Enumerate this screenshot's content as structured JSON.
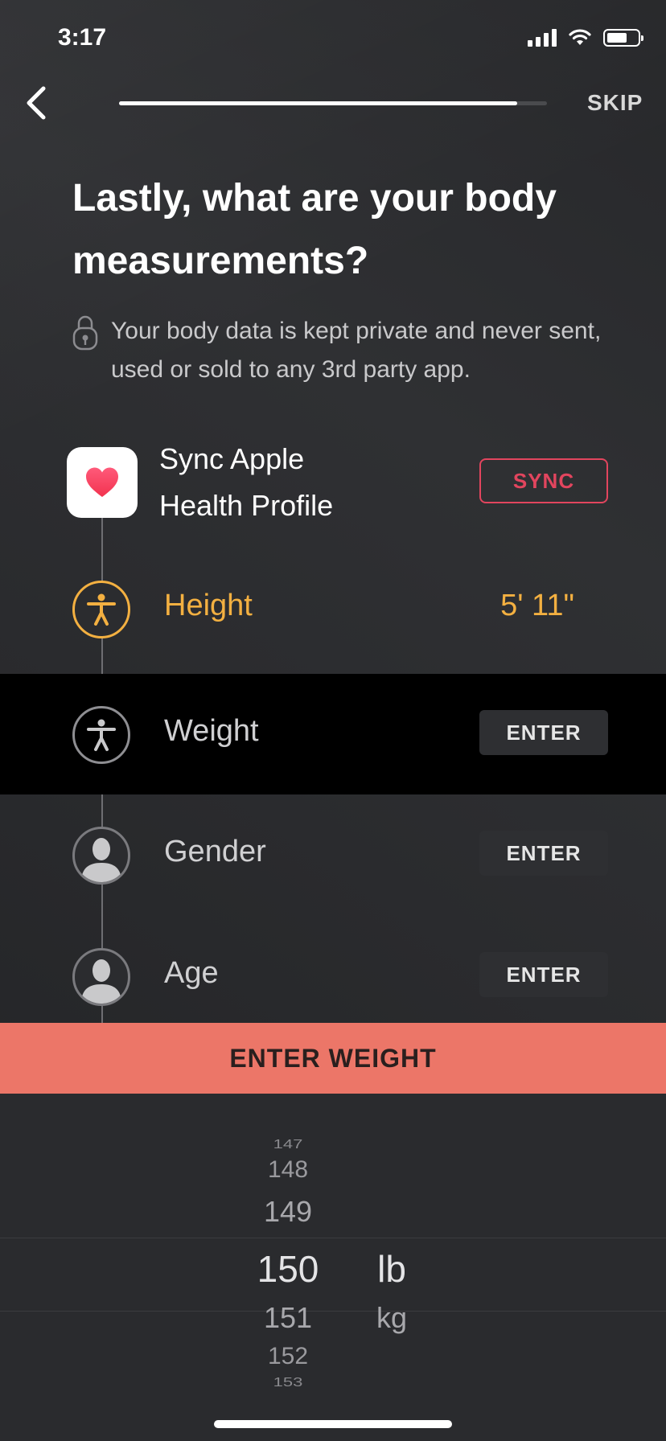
{
  "status_bar": {
    "time": "3:17"
  },
  "nav": {
    "skip_label": "SKIP",
    "progress": 0.93
  },
  "header": {
    "title": "Lastly, what are your body measurements?",
    "privacy_note": "Your body data is kept private and never sent, used or sold to any 3rd party app."
  },
  "sync": {
    "label": "Sync Apple Health Profile",
    "button_label": "SYNC"
  },
  "rows": [
    {
      "label": "Height",
      "value": "5' 11\""
    },
    {
      "label": "Weight",
      "button_label": "ENTER"
    },
    {
      "label": "Gender",
      "button_label": "ENTER"
    },
    {
      "label": "Age",
      "button_label": "ENTER"
    }
  ],
  "enter_weight": {
    "label": "ENTER WEIGHT"
  },
  "picker": {
    "values": [
      "147",
      "148",
      "149",
      "150",
      "151",
      "152",
      "153"
    ],
    "selected_value": "150",
    "units": [
      "lb",
      "kg"
    ],
    "selected_unit": "lb"
  },
  "colors": {
    "accent_height": "#f3b041",
    "sync_red": "#e2455e",
    "cta_coral": "#ec7668"
  }
}
